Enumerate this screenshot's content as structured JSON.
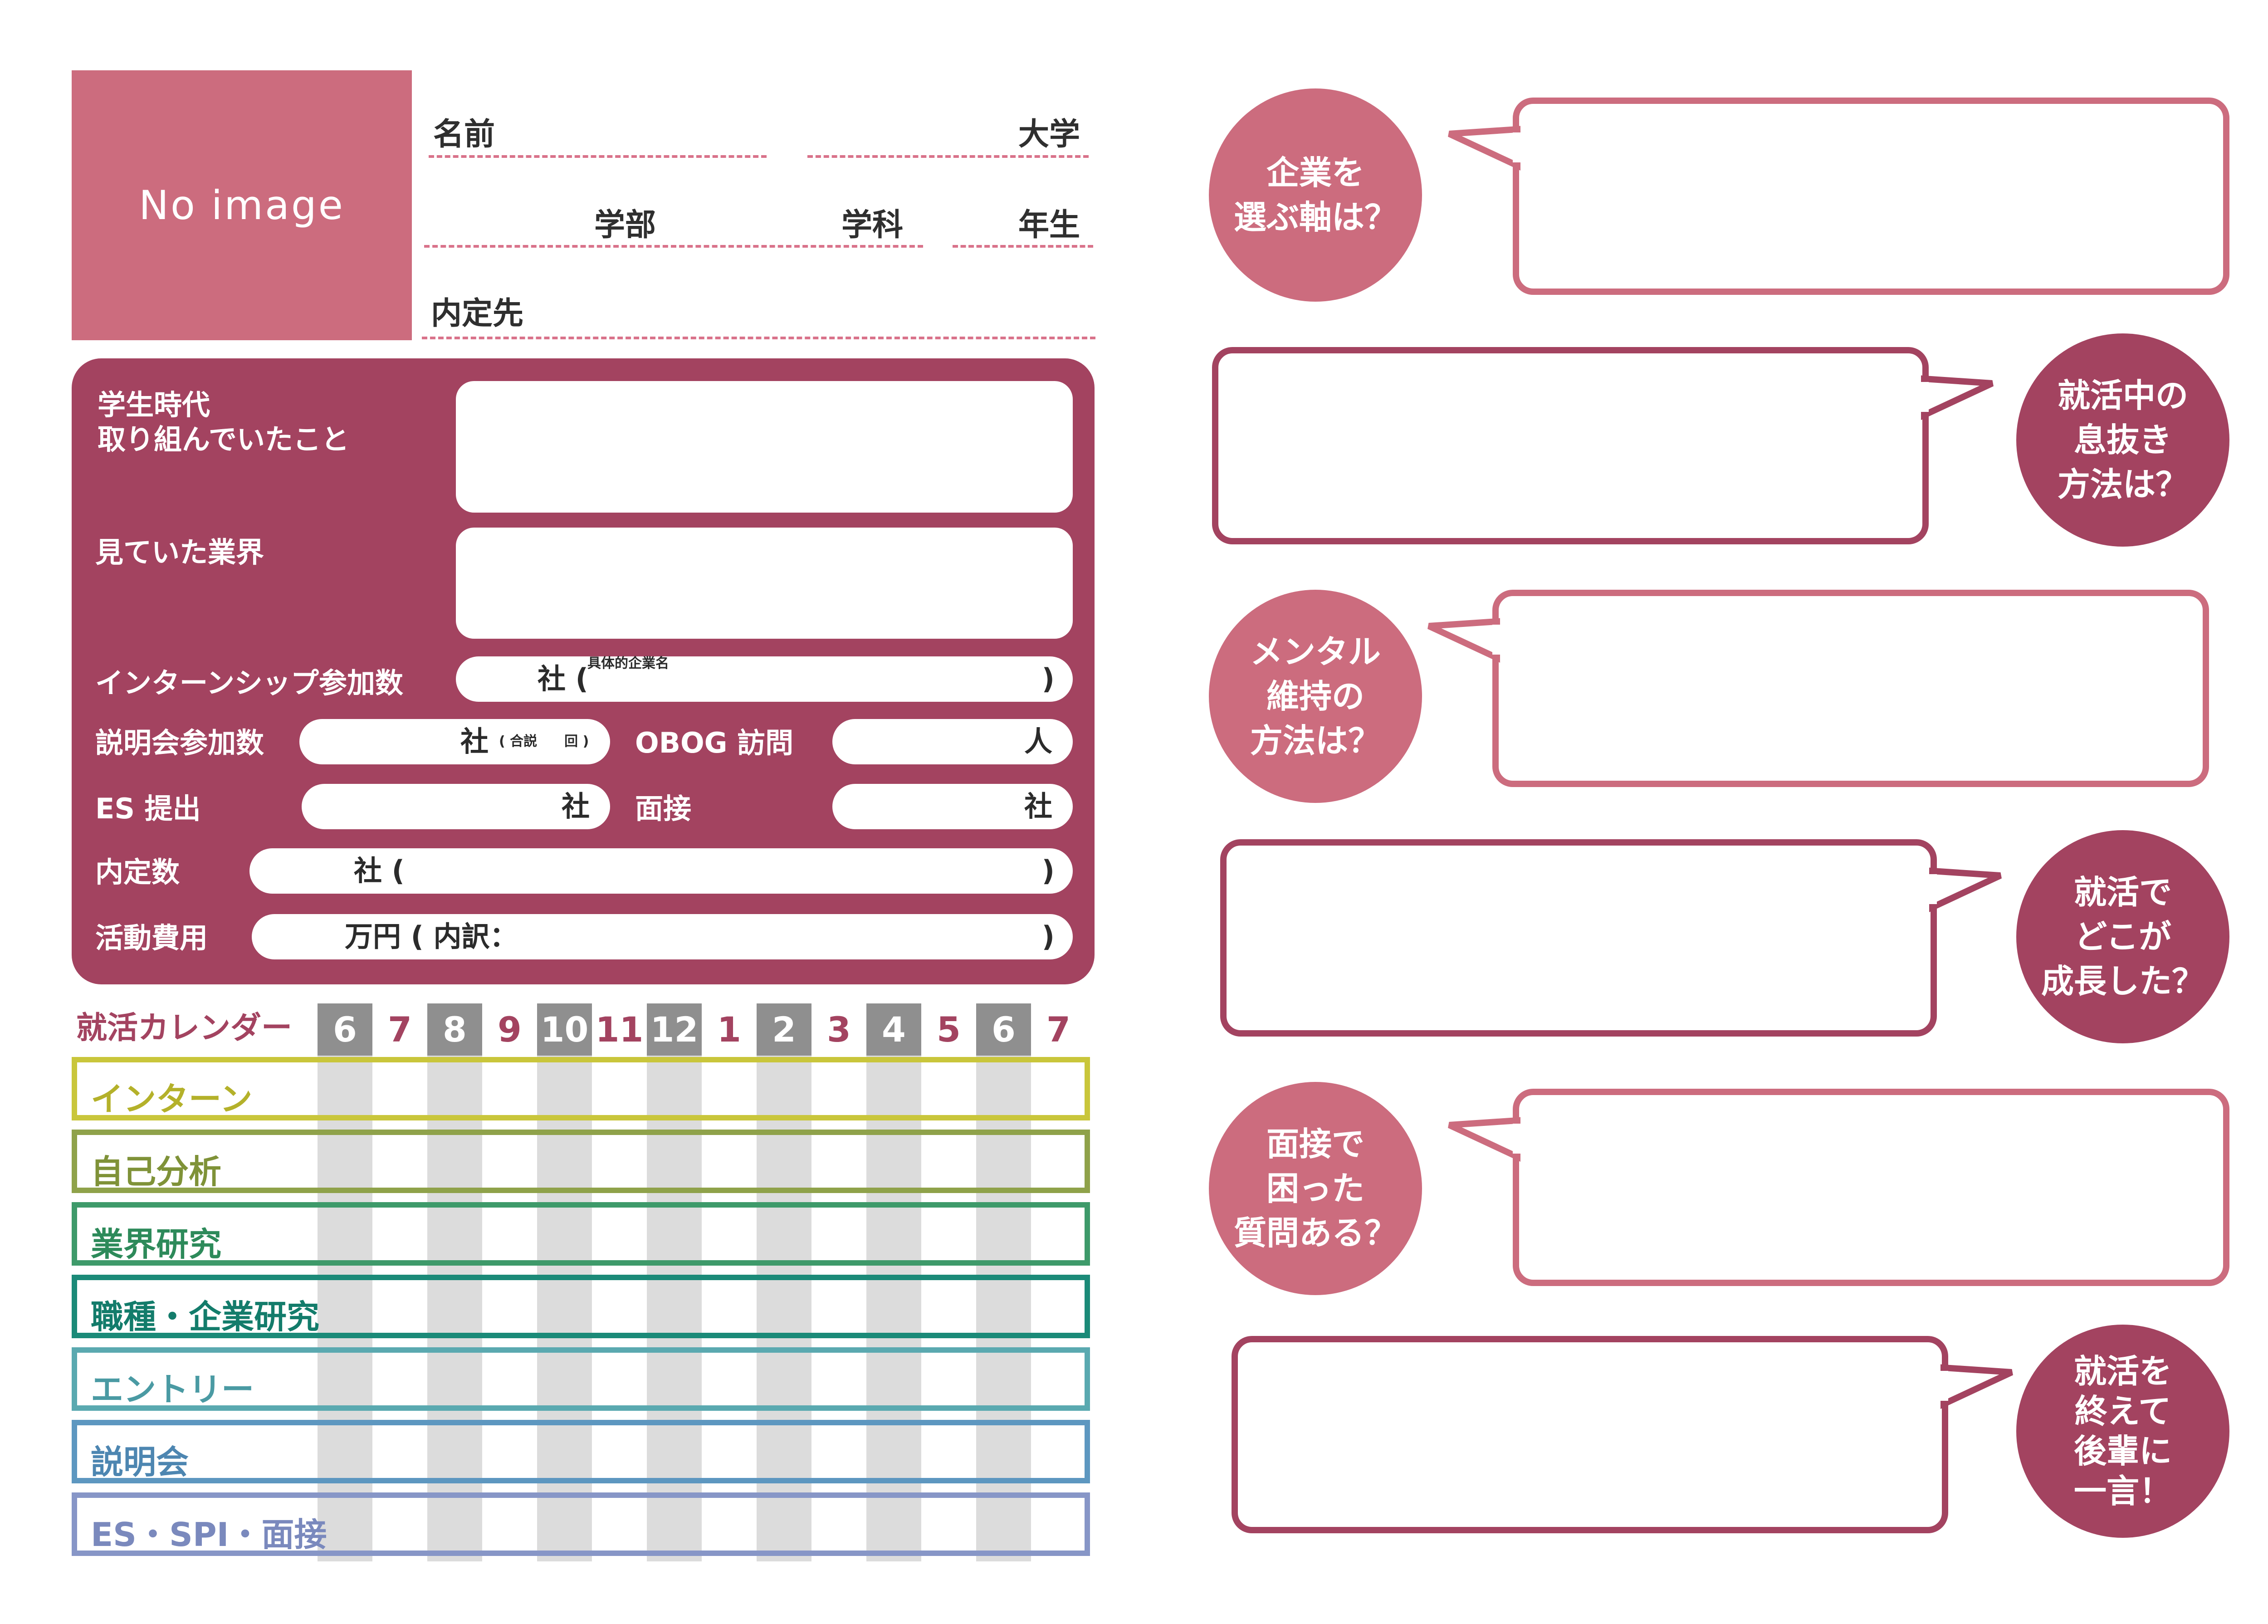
{
  "profile": {
    "photo_placeholder": "No  image",
    "name_label": "名前",
    "university_label": "大学",
    "faculty_label": "学部",
    "department_label": "学科",
    "year_label": "年生",
    "offer_label": "内定先"
  },
  "info": {
    "student_activity_label": "学生時代\n取り組んでいたこと",
    "industries_label": "見ていた業界",
    "internship_label": "インターンシップ参加数",
    "internship_unit": "社 (",
    "internship_note": "具体的企業名",
    "internship_close": ")",
    "seminar_label": "説明会参加数",
    "seminar_unit": "社",
    "seminar_note": "( 合説　　回 )",
    "obog_label": "OBOG 訪問",
    "obog_unit": "人",
    "es_label": "ES 提出",
    "es_unit": "社",
    "interview_label": "面接",
    "interview_unit": "社",
    "offers_label": "内定数",
    "offers_unit": "社 (",
    "offers_close": ")",
    "cost_label": "活動費用",
    "cost_unit": "万円 ( 内訳：",
    "cost_close": ")"
  },
  "calendar": {
    "title": "就活カレンダー",
    "months": [
      "6",
      "7",
      "8",
      "9",
      "10",
      "11",
      "12",
      "1",
      "2",
      "3",
      "4",
      "5",
      "6",
      "7"
    ],
    "rows": [
      {
        "label": "インターン",
        "color": "#c9c63b",
        "text_color": "#b4b12a"
      },
      {
        "label": "自己分析",
        "color": "#8fa24a",
        "text_color": "#7f9238"
      },
      {
        "label": "業界研究",
        "color": "#3e9a6a",
        "text_color": "#2d8a5a"
      },
      {
        "label": "職種・企業研究",
        "color": "#1b8a78",
        "text_color": "#137c6b"
      },
      {
        "label": "エントリー",
        "color": "#5aa9b0",
        "text_color": "#4a9aa3"
      },
      {
        "label": "説明会",
        "color": "#5d97c0",
        "text_color": "#4d86b1"
      },
      {
        "label": "ES・SPI・面接",
        "color": "#8796c7",
        "text_color": "#7a89bd"
      }
    ]
  },
  "questions": [
    {
      "text": "企業を\n選ぶ軸は？"
    },
    {
      "text": "就活中の\n息抜き\n方法は？"
    },
    {
      "text": "メンタル\n維持の\n方法は？"
    },
    {
      "text": "就活で\nどこが\n成長した？"
    },
    {
      "text": "面接で\n困った\n質問ある？"
    },
    {
      "text": "就活を\n終えて\n後輩に\n一言！"
    }
  ],
  "colors": {
    "accent": "#a34360",
    "accent_light": "#cc6c7e",
    "dash": "#d9728a",
    "stripe": "#dcdcdc",
    "month_gray": "#8f8f8f"
  }
}
